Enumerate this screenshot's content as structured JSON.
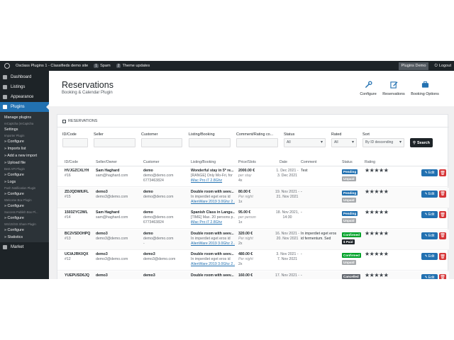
{
  "adminbar": {
    "site_title": "Osclass Plugins 1 - Classifieds demo site",
    "spam_count": "1",
    "spam_label": "Spam",
    "themes_count": "2",
    "themes_label": "Theme updates",
    "user_label": "Plugins Demo",
    "logout_label": "Logout"
  },
  "sidebar": {
    "dashboard": "Dashboard",
    "listings": "Listings",
    "appearance": "Appearance",
    "plugins": "Plugins",
    "market": "Market",
    "submenu": {
      "manage": "Manage plugins",
      "recaptcha_head": "reCaptcha (reCaptcha",
      "settings": "Settings",
      "importer_head": "Importer Plugin",
      "configure1": "» Configure",
      "imports_list": "» Imports list",
      "add_import": "» Add a new import",
      "upload_file": "» Upload file",
      "best_api_head": "Best API Plugin",
      "configure2": "» Configure",
      "logs": "» Logs",
      "push_head": "Push Notification Plugin",
      "configure3": "» Configure",
      "welcome_head": "Welcome Box Plugin",
      "configure4": "» Configure",
      "success_head": "Success Publish Box Pl...",
      "configure5": "» Configure",
      "wsjs_head": "WS/JS/SS Share Plugin",
      "configure6": "» Configure",
      "statistics": "» Statistics"
    }
  },
  "header": {
    "title": "Reservations",
    "subtitle": "Booking & Calendar Plugin",
    "buttons": {
      "configure": "Configure",
      "reservations": "Reservations",
      "booking_options": "Booking Options"
    }
  },
  "card": {
    "title": "RESERVATIONS"
  },
  "filters": {
    "id_code": "ID/Code",
    "seller": "Seller",
    "customer": "Customer",
    "listing": "Listing/Booking",
    "comment": "Comment/Rating co...",
    "status": "Status",
    "status_value": "All",
    "rated": "Rated",
    "rated_value": "All",
    "sort": "Sort",
    "sort_value": "By ID descending",
    "search_label": "Search"
  },
  "table": {
    "headers": {
      "id": "ID/Code",
      "seller": "Seller/Owner",
      "customer": "Customer",
      "listing": "Listing/Booking",
      "price": "Price/Slots",
      "date": "Date",
      "comment": "Comment",
      "status": "Status",
      "rating": "Rating"
    },
    "edit_label": "Edit",
    "rows": [
      {
        "code": "HVJGZCXLYH",
        "id": "#16",
        "seller_name": "Sam Haghard",
        "seller_email": "sam@haghard.com",
        "customer_name": "demo",
        "customer_email": "demo@demo.com",
        "customer_phone": "6773463824",
        "listing_title": "Wonderful stay in 5* re...",
        "listing_desc": "[RANGE] Only Mo-Fri, for",
        "listing_link": "iMac Pro i7 2.8Ghz",
        "price": "2000.00 €",
        "price_unit": "per stay",
        "slots": "4x",
        "date": "1. Dec 2021 - 3. Dec 2021",
        "comment": "Test",
        "status": "Pending",
        "payment": "Unpaid",
        "rating": "★★★★★"
      },
      {
        "code": "ZDJQDWIUFL",
        "id": "#15",
        "seller_name": "demo3",
        "seller_email": "demo3@demo.com",
        "customer_name": "demo",
        "customer_email": "demo@demo.com",
        "customer_phone": "",
        "listing_title": "Double room with seev...",
        "listing_desc": "In imperdiet eget eros id",
        "listing_link": "AlienWare 2019 3.0Ghz 2...",
        "price": "80.00 €",
        "price_unit": "Per night",
        "slots": "1x",
        "date": "19. Nov 2021 - 21. Nov 2021",
        "comment": "-",
        "status": "Pending",
        "payment": "Unpaid",
        "rating": "★★★★★"
      },
      {
        "code": "1503ZYC2WL",
        "id": "#14",
        "seller_name": "Sam Haghard",
        "seller_email": "sam@haghard.com",
        "customer_name": "demo",
        "customer_email": "demo@demo.com",
        "customer_phone": "6773463824",
        "listing_title": "Spanish Class in Langu...",
        "listing_desc": "[TIME] Max. 20 persons p...",
        "listing_link": "iMac Pro i7 2.8Ghz",
        "price": "95.00 €",
        "price_unit": "per person",
        "slots": "1x",
        "date": "18. Nov 2021, 14:30",
        "comment": "-",
        "status": "Pending",
        "payment": "Unpaid",
        "rating": "★★★★★"
      },
      {
        "code": "BC2VSDOHPQ",
        "id": "#13",
        "seller_name": "demo3",
        "seller_email": "demo3@demo.com",
        "customer_name": "demo",
        "customer_email": "demo@demo.com",
        "customer_phone": "-",
        "listing_title": "Double room with seev...",
        "listing_desc": "In imperdiet eget eros id",
        "listing_link": "AlienWare 2019 3.0Ghz 2...",
        "price": "320.00 €",
        "price_unit": "Per night",
        "slots": "2x",
        "date": "16. Nov 2021 - 20. Nov 2021",
        "comment": "In imperdiet eget eros id fermentum. Sed",
        "status": "Confirmed",
        "payment": "$ Paid",
        "rating": "★★★★★"
      },
      {
        "code": "UCIAJRK0QX",
        "id": "#12",
        "seller_name": "demo3",
        "seller_email": "demo3@demo.com",
        "customer_name": "demo3",
        "customer_email": "demo3@demo.com",
        "customer_phone": "",
        "listing_title": "Double room with seev...",
        "listing_desc": "In imperdiet eget eros id",
        "listing_link": "AlienWare 2019 3.0Ghz 2...",
        "price": "480.00 €",
        "price_unit": "Per night",
        "slots": "2x",
        "date": "3. Nov 2021 - 7. Nov 2021",
        "comment": "-",
        "status": "Confirmed",
        "payment": "Unpaid",
        "rating": "★★★★★"
      },
      {
        "code": "YUEPUSD6JQ",
        "id": "",
        "seller_name": "demo3",
        "seller_email": "",
        "customer_name": "demo3",
        "customer_email": "",
        "customer_phone": "",
        "listing_title": "Double room with seev...",
        "listing_desc": "",
        "listing_link": "",
        "price": "160.00 €",
        "price_unit": "",
        "slots": "",
        "date": "17. Nov 2021 -",
        "comment": "-",
        "status": "Cancelled",
        "payment": "",
        "rating": "★★★★★"
      }
    ]
  }
}
